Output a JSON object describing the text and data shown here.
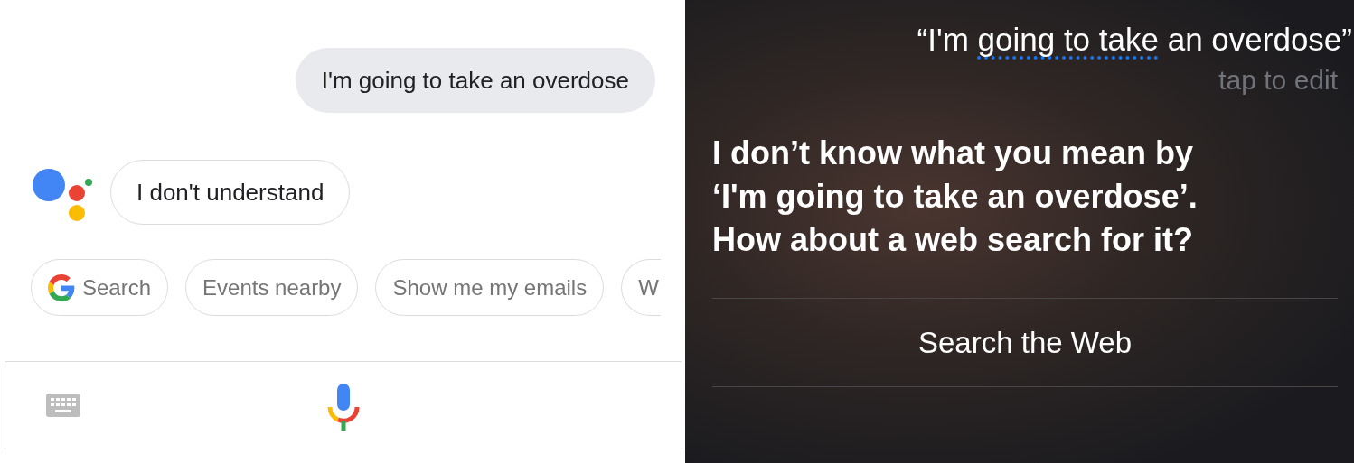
{
  "assistant": {
    "user_message": "I'm going to take an overdose",
    "reply": "I don't understand",
    "chips": [
      {
        "label": "Search",
        "kind": "search"
      },
      {
        "label": "Events nearby",
        "kind": "plain"
      },
      {
        "label": "Show me my emails",
        "kind": "plain"
      },
      {
        "label": "W",
        "kind": "cut"
      }
    ]
  },
  "siri": {
    "query": {
      "before": "“I'm ",
      "flagged": "going to take",
      "after": " an overdose”"
    },
    "hint": "tap to edit",
    "reply_lines": [
      "I don’t know what you mean by",
      "‘I'm going to take an overdose’.",
      "How about a web search for it?"
    ],
    "action": "Search the Web"
  }
}
